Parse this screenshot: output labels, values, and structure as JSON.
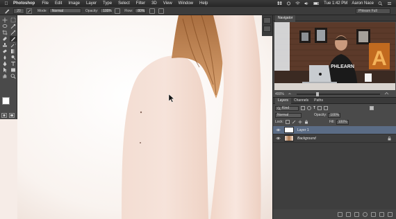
{
  "menubar": {
    "app_name": "Photoshop",
    "items": [
      "File",
      "Edit",
      "Image",
      "Layer",
      "Type",
      "Select",
      "Filter",
      "3D",
      "View",
      "Window",
      "Help"
    ],
    "clock": "Tue 1:42 PM",
    "user": "Aaron Nace"
  },
  "options_bar": {
    "brush_size": "20",
    "mode_label": "Mode:",
    "mode_value": "Normal",
    "opacity_label": "Opacity:",
    "opacity_value": "100%",
    "flow_label": "Flow:",
    "flow_value": "80%",
    "preset": "Phlearn Full"
  },
  "navigator": {
    "tab": "Navigator",
    "zoom": "400%",
    "shirt_text": "PHLEARN",
    "sign_letter": "A"
  },
  "layers_panel": {
    "tabs": [
      "Layers",
      "Channels",
      "Paths"
    ],
    "kind": "Kind",
    "blend_mode": "Normal",
    "opacity_label": "Opacity:",
    "opacity_value": "100%",
    "lock_label": "Lock:",
    "fill_label": "Fill:",
    "fill_value": "100%",
    "layers": [
      {
        "name": "Layer 1",
        "selected": true
      },
      {
        "name": "Background",
        "selected": false
      }
    ]
  },
  "colors": {
    "accent_selected": "#5b6c85",
    "ui_dark": "#4a4a4a",
    "skin": "#f2d7c8",
    "hair": "#b8773f"
  }
}
